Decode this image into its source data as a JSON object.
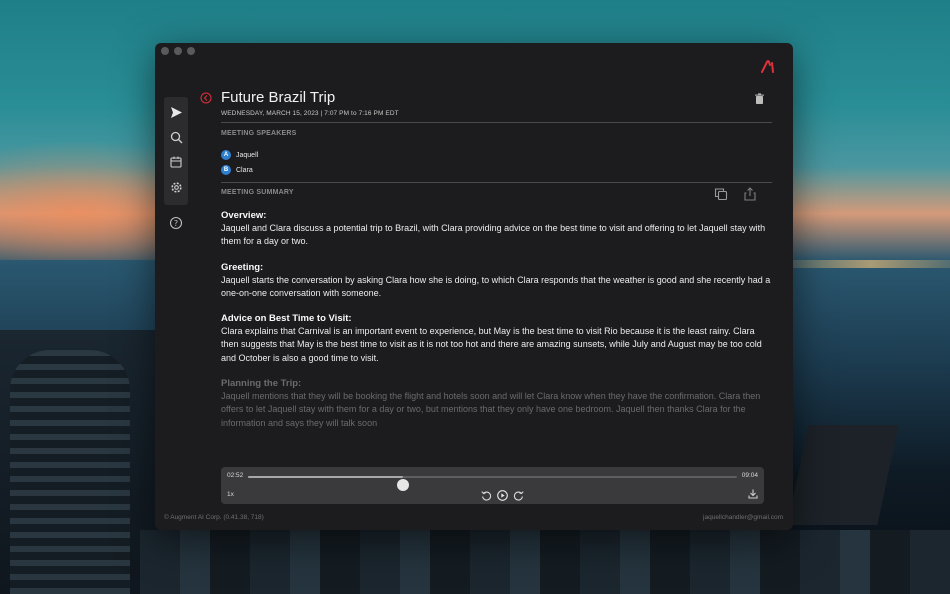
{
  "window": {
    "title": "Future Brazil Trip",
    "subtitle": "WEDNESDAY, MARCH 15, 2023 | 7:07 PM to 7:16 PM EDT"
  },
  "speakers_section": {
    "heading": "MEETING SPEAKERS",
    "speakers": [
      {
        "initial": "A",
        "name": "Jaquell"
      },
      {
        "initial": "B",
        "name": "Clara"
      }
    ]
  },
  "summary_section": {
    "heading": "MEETING SUMMARY",
    "blocks": [
      {
        "heading": "Overview:",
        "text": "Jaquell and Clara discuss a potential trip to Brazil, with Clara providing advice on the best time to visit and offering to let Jaquell stay with them for a day or two."
      },
      {
        "heading": "Greeting:",
        "text": "Jaquell starts the conversation by asking Clara how she is doing, to which Clara responds that the weather is good and she recently had a one-on-one conversation with someone."
      },
      {
        "heading": "Advice on Best Time to Visit:",
        "text": "Clara explains that Carnival is an important event to experience, but May is the best time to visit Rio because it is the least rainy. Clara then suggests that May is the best time to visit as it is not too hot and there are amazing sunsets, while July and August may be too cold and October is also a good time to visit."
      },
      {
        "heading": "Planning the Trip:",
        "text": "Jaquell mentions that they will be booking the flight and hotels soon and will let Clara know when they have the confirmation. Clara then offers to let Jaquell stay with them for a day or two, but mentions that they only have one bedroom. Jaquell then thanks Clara for the information and says they will talk soon"
      }
    ]
  },
  "player": {
    "current_time": "02:52",
    "total_time": "09:04",
    "progress_fraction": 0.316,
    "speed": "1x"
  },
  "footer": {
    "copyright": "© Augment AI Corp.   (0.41.38, 718)",
    "email": "jaquellchandler@gmail.com"
  },
  "colors": {
    "accent": "#e0303a",
    "speaker_badge": "#2f7fd0",
    "window_bg": "#1c1c1e"
  },
  "icons": [
    "send-icon",
    "search-icon",
    "calendar-icon",
    "gear-icon",
    "help-icon",
    "back-icon",
    "trash-icon",
    "copy-icon",
    "share-icon",
    "rewind-icon",
    "play-icon",
    "forward-icon",
    "download-icon",
    "app-logo-icon",
    "chevron-up-icon"
  ]
}
